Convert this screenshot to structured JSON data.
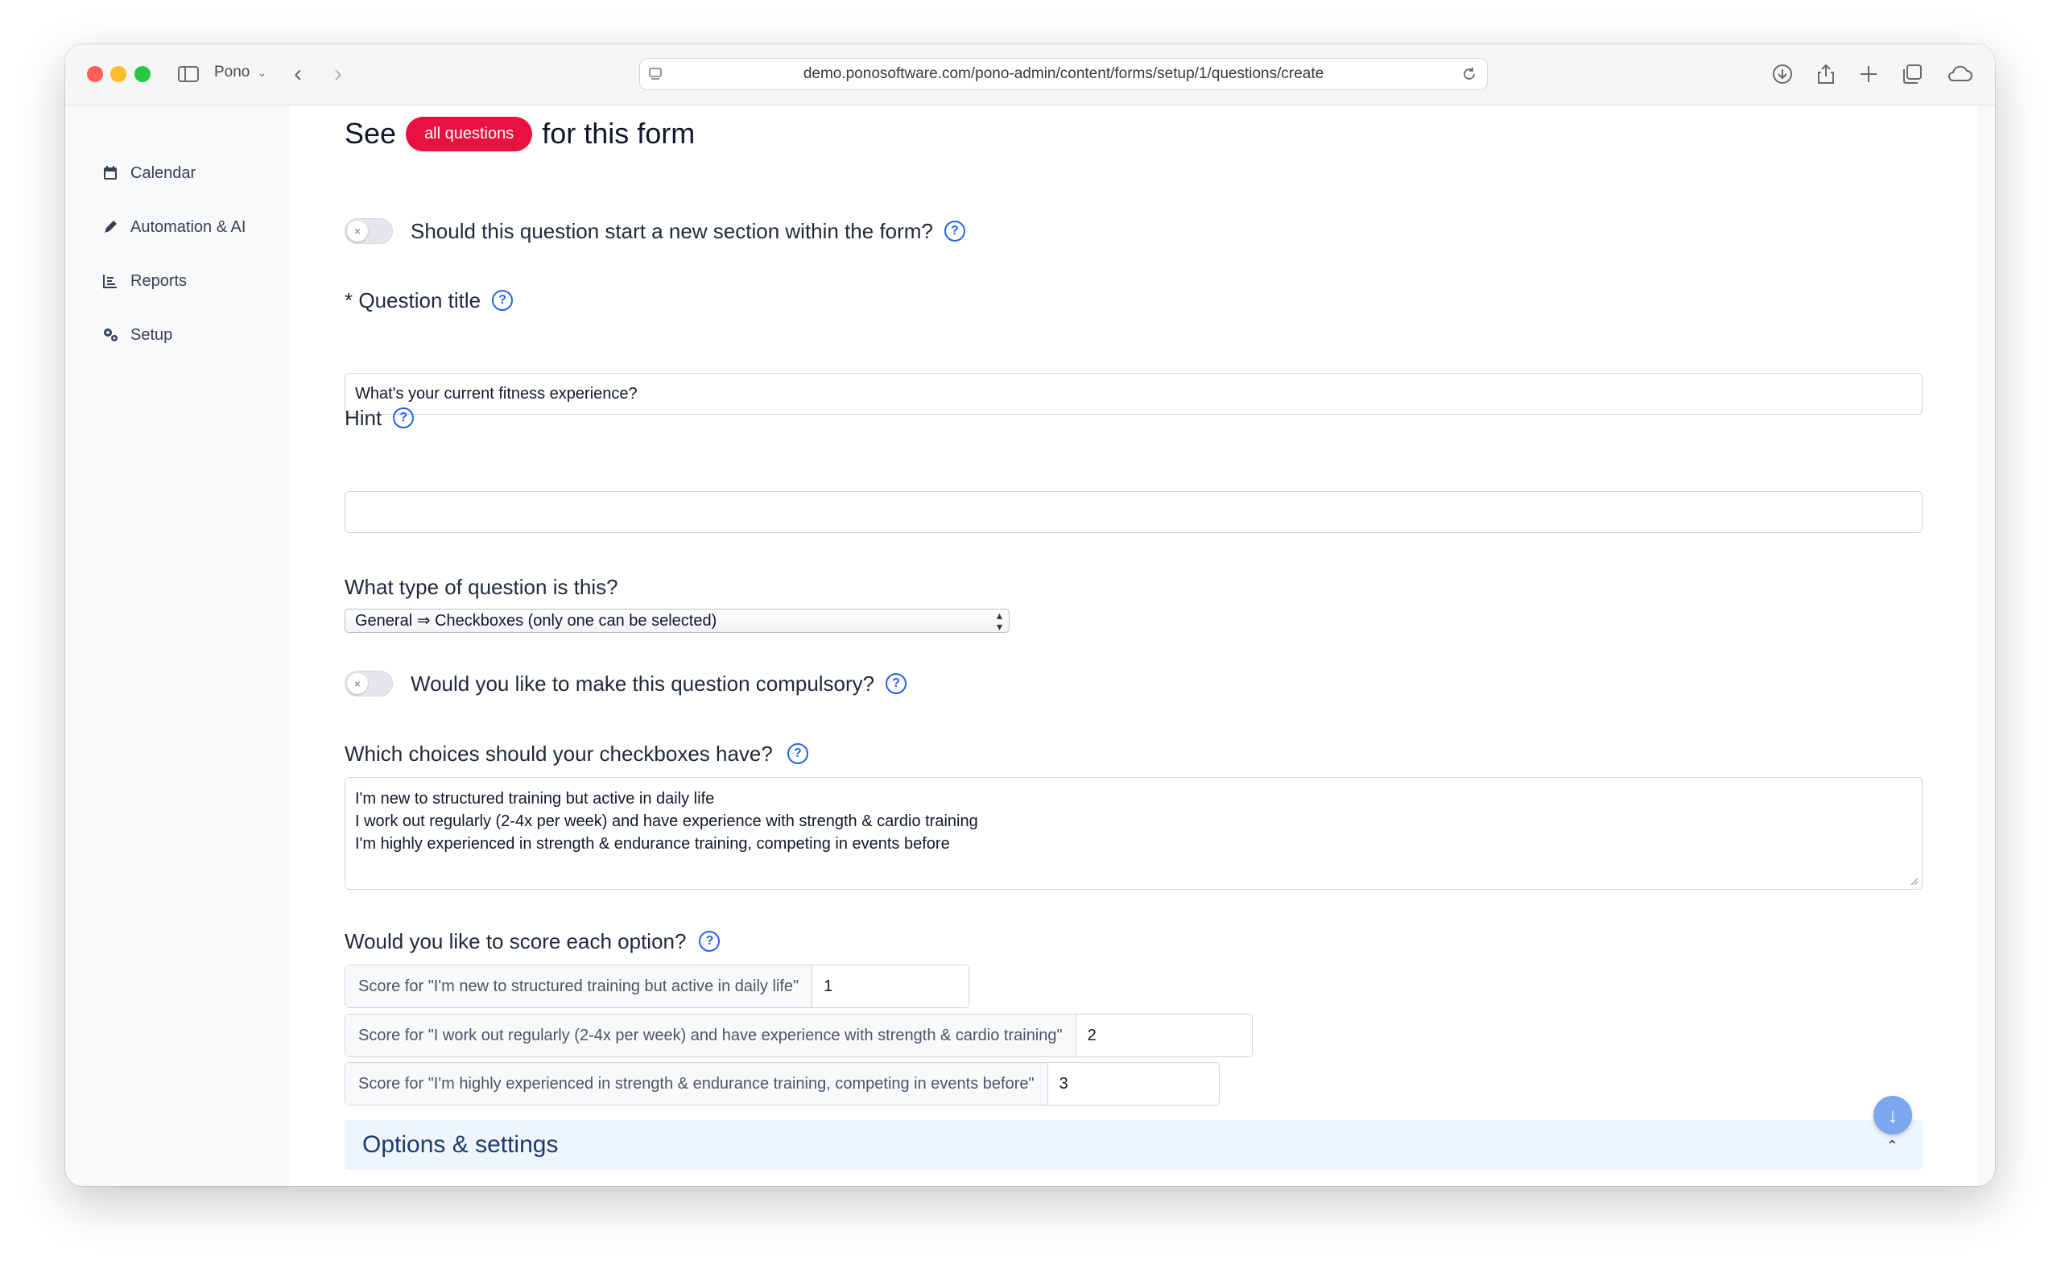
{
  "browser": {
    "profile": "Pono",
    "url": "demo.ponosoftware.com/pono-admin/content/forms/setup/1/questions/create"
  },
  "nav": {
    "items": [
      {
        "label": "Calendar",
        "icon": "calendar-icon"
      },
      {
        "label": "Automation & AI",
        "icon": "pencil-icon"
      },
      {
        "label": "Reports",
        "icon": "chart-icon"
      },
      {
        "label": "Setup",
        "icon": "gears-icon"
      }
    ]
  },
  "header": {
    "see": "See",
    "pill": "all questions",
    "suffix": "for this form"
  },
  "form": {
    "new_section_label": "Should this question start a new section within the form?",
    "title_label": "* Question title",
    "title_value": "What's your current fitness experience?",
    "hint_label": "Hint",
    "hint_value": "",
    "type_label": "What type of question is this?",
    "type_value": "General ⇒ Checkboxes (only one can be selected)",
    "compulsory_label": "Would you like to make this question compulsory?",
    "choices_label": "Which choices should your checkboxes have?",
    "choices": [
      "I'm new to structured training but active in daily life",
      "I work out regularly (2-4x per week) and have experience with strength & cardio training",
      "I'm highly experienced in strength & endurance training, competing in events before"
    ],
    "score_label": "Would you like to score each option?",
    "scores": [
      {
        "label": "Score for \"I'm new to structured training but active in daily life\"",
        "value": "1"
      },
      {
        "label": "Score for \"I work out regularly (2-4x per week) and have experience with strength & cardio training\"",
        "value": "2"
      },
      {
        "label": "Score for \"I'm highly experienced in strength & endurance training, competing in events before\"",
        "value": "3"
      }
    ],
    "options_title": "Options & settings"
  },
  "colors": {
    "accent": "#e8113f",
    "help": "#2563eb",
    "options_bg": "#eef5fd"
  }
}
